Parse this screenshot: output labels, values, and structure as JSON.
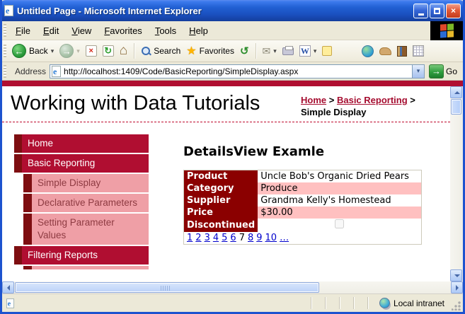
{
  "window": {
    "title": "Untitled Page - Microsoft Internet Explorer"
  },
  "menu_bar": {
    "items": [
      "File",
      "Edit",
      "View",
      "Favorites",
      "Tools",
      "Help"
    ]
  },
  "toolbar": {
    "back_label": "Back",
    "search_label": "Search",
    "favorites_label": "Favorites"
  },
  "address_bar": {
    "label": "Address",
    "url": "http://localhost:1409/Code/BasicReporting/SimpleDisplay.aspx",
    "go_label": "Go"
  },
  "icons": {
    "ie_e": "e",
    "back_arrow": "←",
    "forward_arrow": "→",
    "dropdown_caret": "▾",
    "stop_x": "×",
    "refresh": "↻",
    "home": "⌂",
    "favorites_star": "★",
    "history": "↺",
    "mail": "✉",
    "word_w": "W",
    "go_arrow": "→",
    "close_x": "×"
  },
  "page": {
    "title": "Working with Data Tutorials",
    "breadcrumb": {
      "links": [
        "Home",
        "Basic Reporting"
      ],
      "separator": ">",
      "current": "Simple Display"
    },
    "sidebar": {
      "items": [
        {
          "label": "Home",
          "level": "top"
        },
        {
          "label": "Basic Reporting",
          "level": "top"
        },
        {
          "label": "Simple Display",
          "level": "sub"
        },
        {
          "label": "Declarative Parameters",
          "level": "sub"
        },
        {
          "label": "Setting Parameter Values",
          "level": "sub"
        },
        {
          "label": "Filtering Reports",
          "level": "top"
        }
      ]
    },
    "main": {
      "heading": "DetailsView Examle",
      "details_table": {
        "rows": [
          {
            "label": "Product",
            "value": "Uncle Bob's Organic Dried Pears"
          },
          {
            "label": "Category",
            "value": "Produce"
          },
          {
            "label": "Supplier",
            "value": "Grandma Kelly's Homestead"
          },
          {
            "label": "Price",
            "value": "$30.00"
          },
          {
            "label": "Discontinued",
            "value": "",
            "checkbox_checked": false
          }
        ],
        "pager": {
          "pages": [
            "1",
            "2",
            "3",
            "4",
            "5",
            "6",
            "7",
            "8",
            "9",
            "10",
            "…"
          ],
          "current": "7"
        }
      }
    }
  },
  "status_bar": {
    "zone_label": "Local intranet"
  },
  "colors": {
    "accent_crimson": "#B00E31",
    "shadow_maroon": "#7E0E11",
    "table_header_red": "#8B0000",
    "submenu_pink": "#EF9FA6",
    "submenu_text": "#8E3B42",
    "alt_row_pink": "#FFC0C0",
    "pager_link_blue": "#0000CC",
    "breadcrumb_maroon": "#A50C2F",
    "chrome_tan": "#ECE9D8",
    "titlebar_blue": "#2160D3"
  }
}
